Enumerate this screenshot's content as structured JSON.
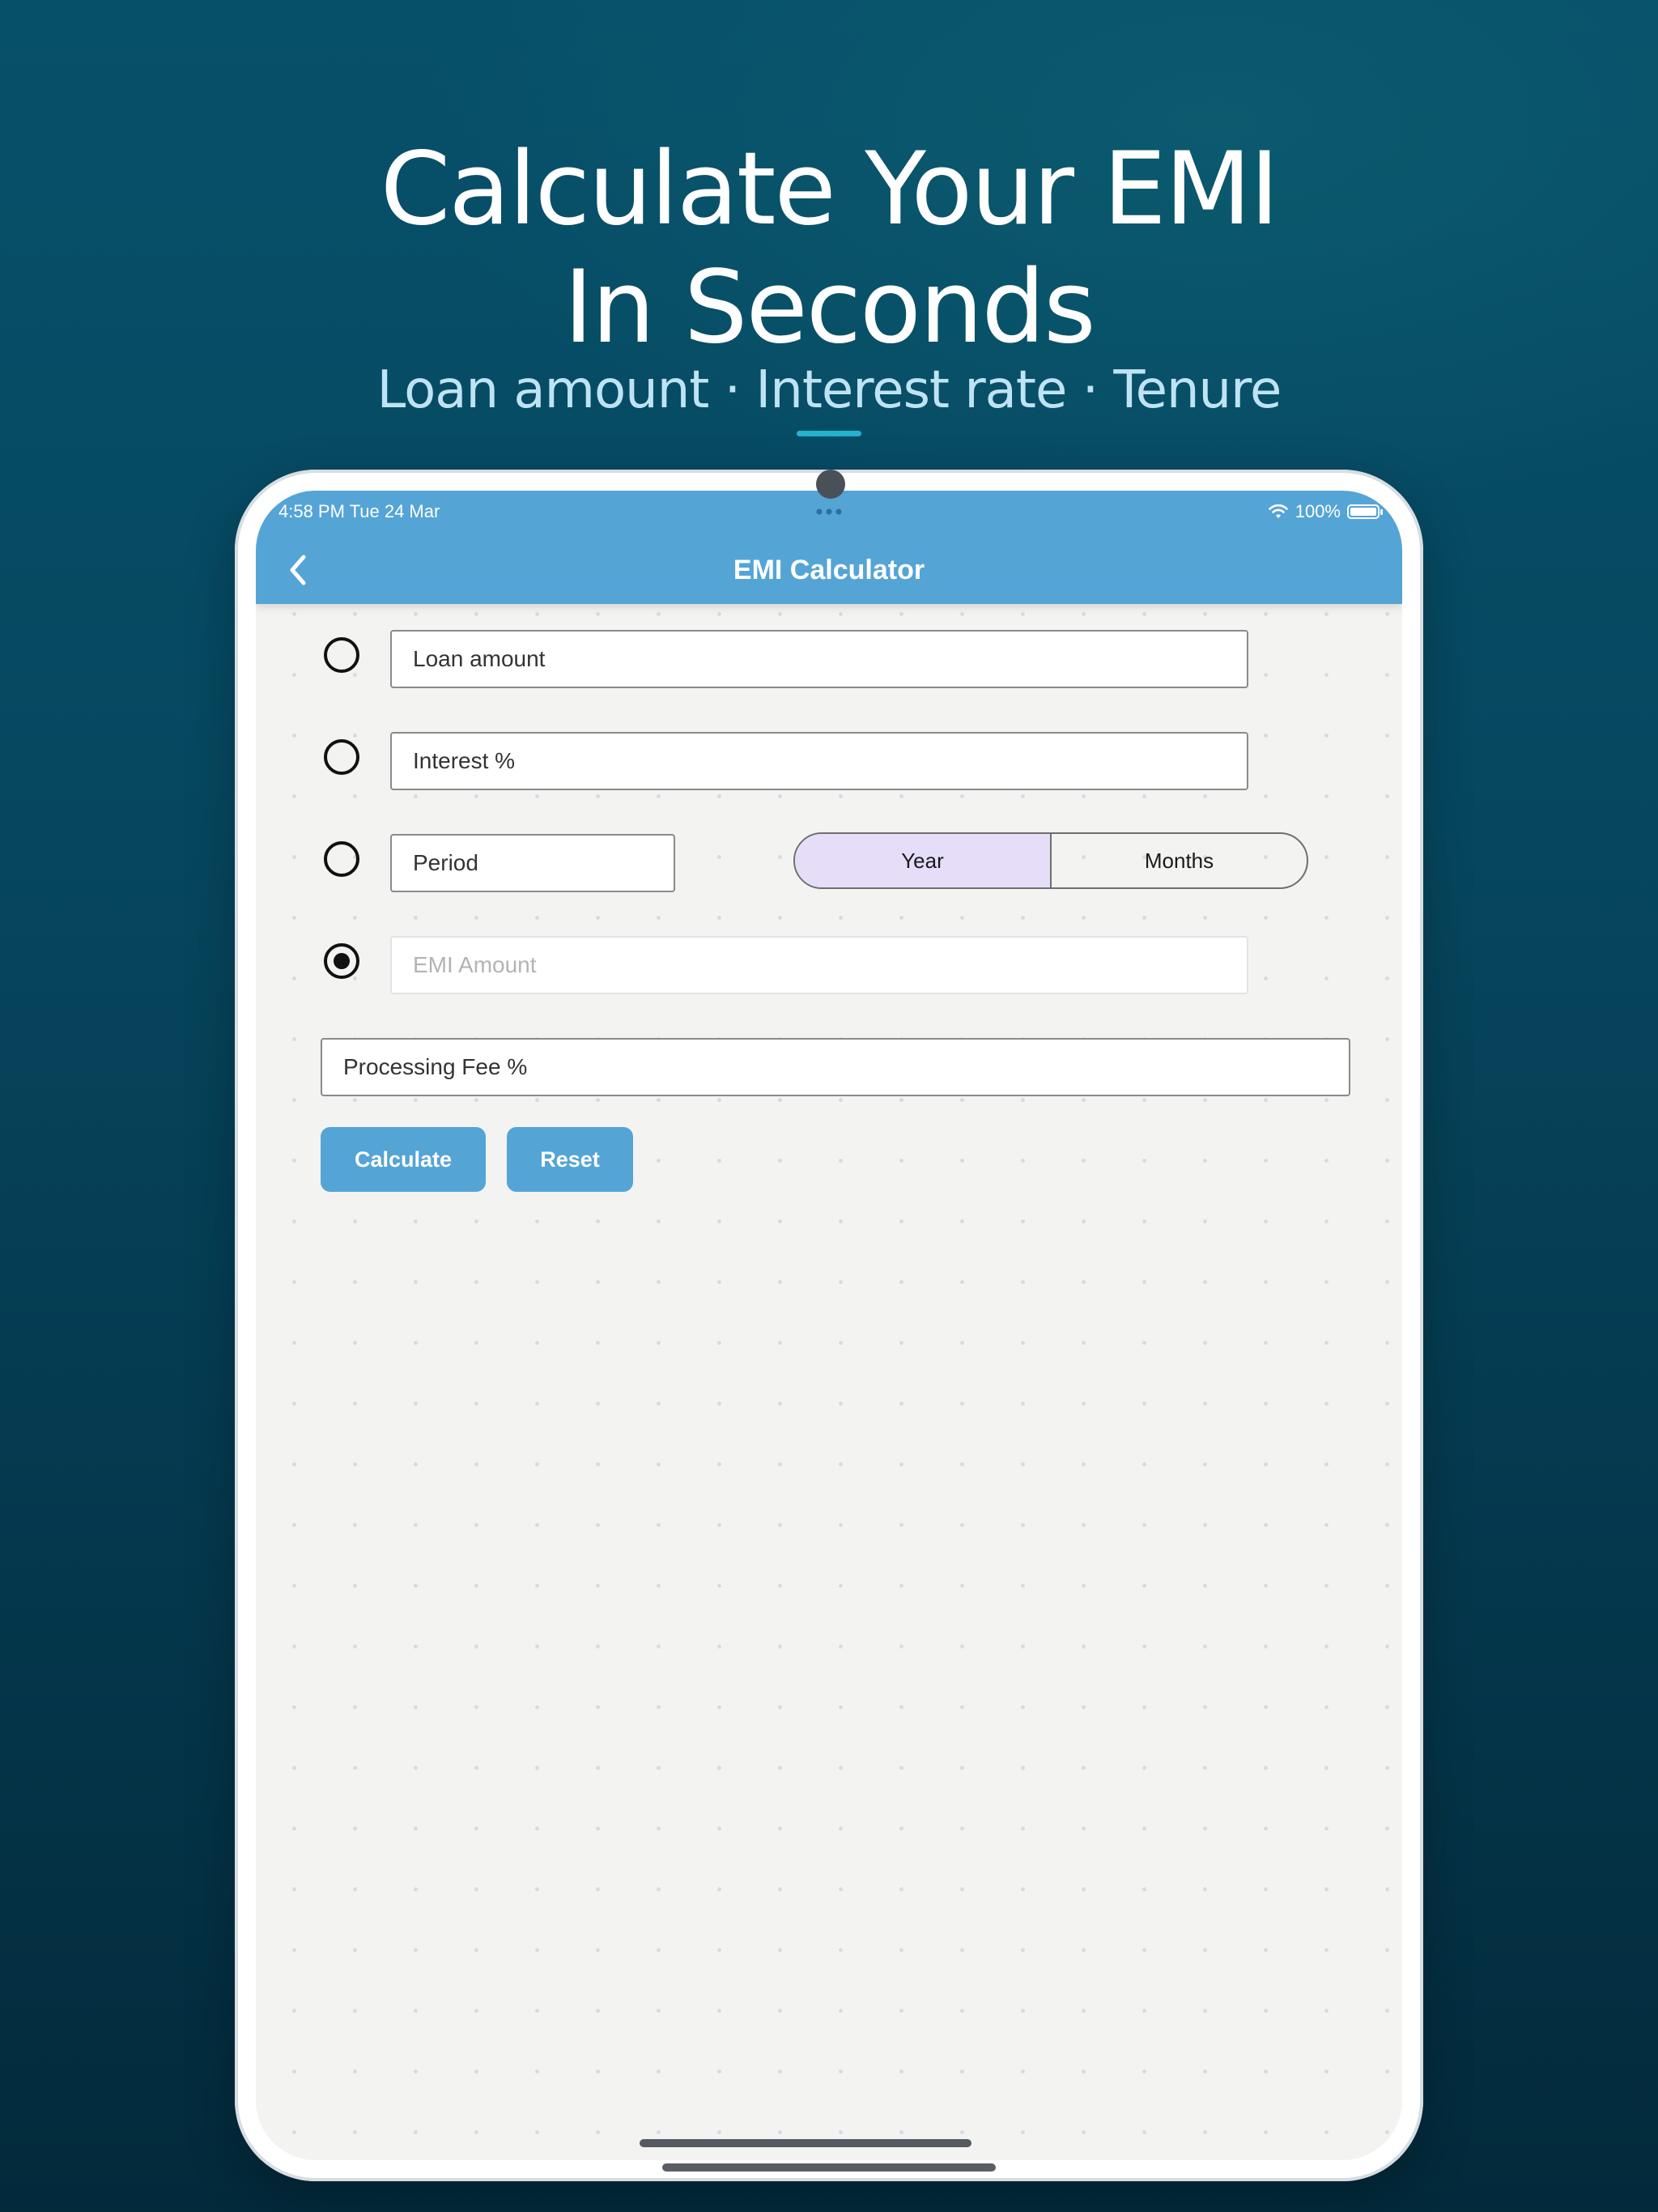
{
  "promo": {
    "headline_line1": "Calculate Your EMI",
    "headline_line2": "In Seconds",
    "subline": "Loan amount · Interest rate · Tenure"
  },
  "status_bar": {
    "time_date": "4:58 PM   Tue 24 Mar",
    "battery": "100%",
    "icons": [
      "wifi-icon",
      "battery-icon",
      "multitasking-dots-icon"
    ]
  },
  "app_bar": {
    "title": "EMI Calculator",
    "back_icon": "chevron-left-icon"
  },
  "form": {
    "loan_amount": {
      "placeholder": "Loan amount",
      "selected": false
    },
    "interest": {
      "placeholder": "Interest %",
      "selected": false
    },
    "period": {
      "placeholder": "Period",
      "selected": false
    },
    "emi_amount": {
      "placeholder": "EMI Amount",
      "selected": true
    },
    "processing_fee": {
      "placeholder": "Processing Fee %"
    },
    "period_unit": {
      "options": [
        "Year",
        "Months"
      ],
      "selected": "Year"
    }
  },
  "actions": {
    "calculate": "Calculate",
    "reset": "Reset"
  },
  "colors": {
    "app_bar": "#55a4d6",
    "button": "#55a4d6",
    "segment_active": "#e6def8",
    "background_top": "#07506a",
    "background_bottom": "#032a3b",
    "accent": "#22b4cf"
  }
}
